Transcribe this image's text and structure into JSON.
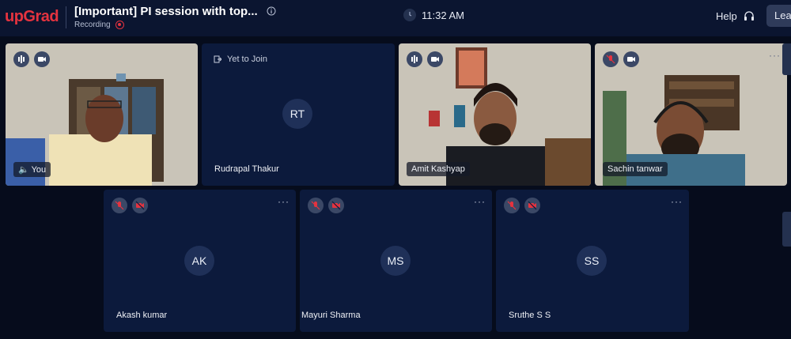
{
  "header": {
    "logo": "upGrad",
    "title": "[Important] PI session with top...",
    "recording_label": "Recording",
    "time": "11:32 AM",
    "help_label": "Help",
    "leave_label": "Leave"
  },
  "participants": [
    {
      "name": "You",
      "initials": "",
      "has_video": true
    },
    {
      "name": "Rudrapal Thakur",
      "initials": "RT",
      "has_video": false,
      "status": "Yet to Join"
    },
    {
      "name": "Amit Kashyap",
      "initials": "",
      "has_video": true
    },
    {
      "name": "Sachin tanwar",
      "initials": "",
      "has_video": true
    },
    {
      "name": "Akash kumar",
      "initials": "AK",
      "has_video": false
    },
    {
      "name": "Mayuri Sharma",
      "initials": "MS",
      "has_video": false
    },
    {
      "name": "Sruthe S S",
      "initials": "SS",
      "has_video": false
    }
  ],
  "colors": {
    "background": "#060c1c",
    "tile": "#0c1a3c",
    "brand_red": "#e5333f",
    "muted_red": "#e5333f"
  },
  "more_label": "···"
}
